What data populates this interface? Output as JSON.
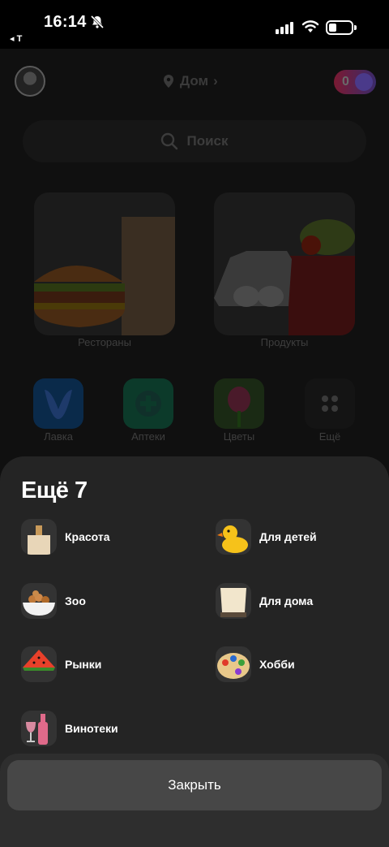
{
  "status_bar": {
    "time": "16:14",
    "back_label": "◂ T"
  },
  "header": {
    "address": "Дом",
    "cashback_value": "0"
  },
  "search": {
    "placeholder": "Поиск"
  },
  "main_categories": [
    {
      "label": "Рестораны"
    },
    {
      "label": "Продукты"
    }
  ],
  "quick_categories": [
    {
      "label": "Лавка"
    },
    {
      "label": "Аптеки"
    },
    {
      "label": "Цветы"
    },
    {
      "label": "Ещё"
    }
  ],
  "sheet": {
    "title": "Ещё 7",
    "items": [
      {
        "label": "Красота",
        "icon": "beauty-icon"
      },
      {
        "label": "Для детей",
        "icon": "rubber-duck-icon"
      },
      {
        "label": "Зоо",
        "icon": "pet-food-bowl-icon"
      },
      {
        "label": "Для дома",
        "icon": "lamp-icon"
      },
      {
        "label": "Рынки",
        "icon": "watermelon-icon"
      },
      {
        "label": "Хобби",
        "icon": "paint-palette-icon"
      },
      {
        "label": "Винотеки",
        "icon": "wine-icon"
      }
    ],
    "close_label": "Закрыть"
  },
  "colors": {
    "sheet_background": "#242424",
    "close_button": "#474747"
  }
}
